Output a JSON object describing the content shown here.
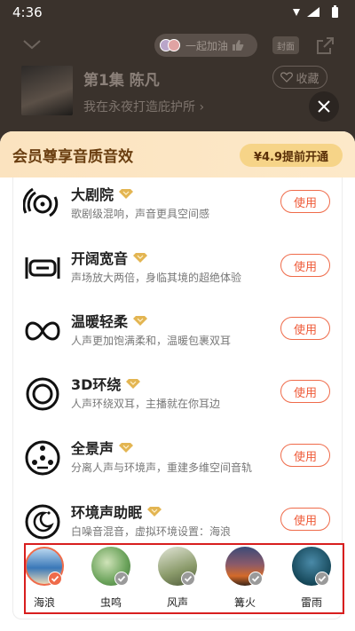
{
  "status": {
    "time": "4:36"
  },
  "header": {
    "cheer_text": "一起加油",
    "cover_label": "封面"
  },
  "episode": {
    "title": "第1集 陈凡",
    "subtitle": "我在永夜打造庇护所",
    "fav_label": "收藏"
  },
  "sheet": {
    "banner_title": "会员尊享音质音效",
    "banner_button": "¥4.9提前开通",
    "items": [
      {
        "name": "大剧院",
        "desc": "歌剧级混响，声音更具空间感",
        "button": "使用",
        "icon": "theater-icon"
      },
      {
        "name": "开阔宽音",
        "desc": "声场放大两倍，身临其境的超绝体验",
        "button": "使用",
        "icon": "wide-sound-icon"
      },
      {
        "name": "温暖轻柔",
        "desc": "人声更加饱满柔和，温暖包裹双耳",
        "button": "使用",
        "icon": "warm-soft-icon"
      },
      {
        "name": "3D环绕",
        "desc": "人声环绕双耳，主播就在你耳边",
        "button": "使用",
        "icon": "surround-3d-icon"
      },
      {
        "name": "全景声",
        "desc": "分离人声与环境声，重建多维空间音轨",
        "button": "使用",
        "icon": "panoramic-icon"
      },
      {
        "name": "环境声助眠",
        "desc": "白噪音混音，虚拟环境设置：海浪",
        "button": "使用",
        "icon": "sleep-moon-icon"
      }
    ],
    "scenes": [
      {
        "label": "海浪",
        "selected": true,
        "c1": "#3a78b8",
        "c2": "#b8d6ee"
      },
      {
        "label": "虫鸣",
        "selected": false,
        "c1": "#6aa25a",
        "c2": "#cfe3b8"
      },
      {
        "label": "风声",
        "selected": false,
        "c1": "#8a9a6a",
        "c2": "#e3e6d8"
      },
      {
        "label": "篝火",
        "selected": false,
        "c1": "#d36a2a",
        "c2": "#3b4a78"
      },
      {
        "label": "雷雨",
        "selected": false,
        "c1": "#16485a",
        "c2": "#4a8aa8"
      }
    ]
  },
  "colors": {
    "accent": "#ef5a38",
    "badge": "#e3b552",
    "banner": "#fde9c9"
  }
}
